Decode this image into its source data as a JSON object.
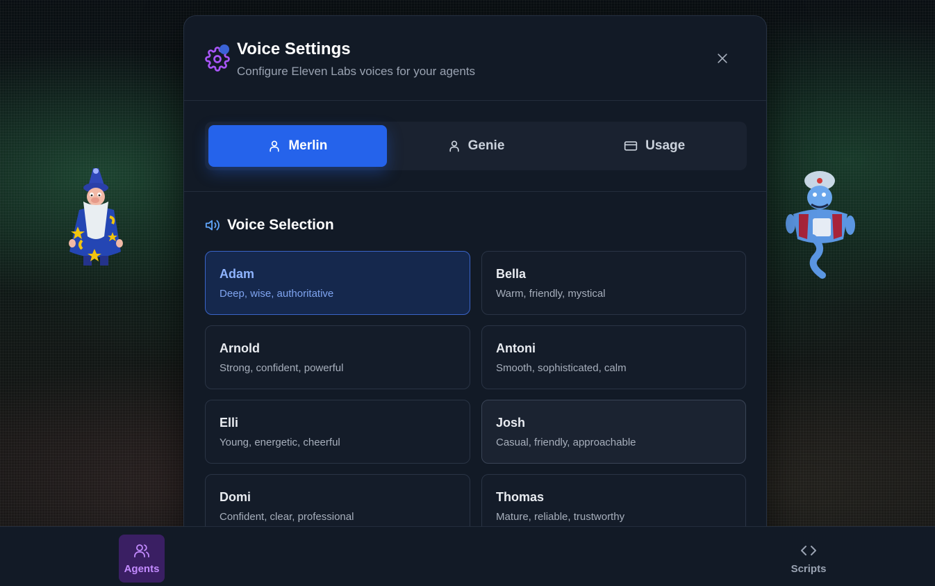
{
  "modal": {
    "title": "Voice Settings",
    "subtitle": "Configure Eleven Labs voices for your agents",
    "tabs": [
      {
        "label": "Merlin",
        "icon": "user-icon",
        "active": true
      },
      {
        "label": "Genie",
        "icon": "user-icon",
        "active": false
      },
      {
        "label": "Usage",
        "icon": "credit-card-icon",
        "active": false
      }
    ],
    "section_title": "Voice Selection",
    "voices": [
      {
        "name": "Adam",
        "description": "Deep, wise, authoritative",
        "selected": true
      },
      {
        "name": "Bella",
        "description": "Warm, friendly, mystical"
      },
      {
        "name": "Arnold",
        "description": "Strong, confident, powerful"
      },
      {
        "name": "Antoni",
        "description": "Smooth, sophisticated, calm"
      },
      {
        "name": "Elli",
        "description": "Young, energetic, cheerful"
      },
      {
        "name": "Josh",
        "description": "Casual, friendly, approachable"
      },
      {
        "name": "Domi",
        "description": "Confident, clear, professional"
      },
      {
        "name": "Thomas",
        "description": "Mature, reliable, trustworthy"
      }
    ]
  },
  "bottom_nav": {
    "agents_label": "Agents",
    "scripts_label": "Scripts"
  },
  "colors": {
    "accent": "#2563eb",
    "agents_active": "#c38bff",
    "settings_icon": "#a855f7"
  }
}
